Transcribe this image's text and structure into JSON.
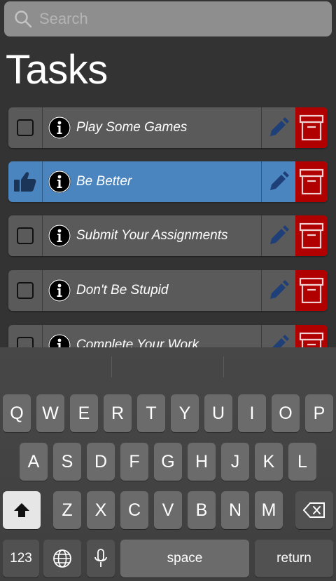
{
  "search": {
    "placeholder": "Search"
  },
  "page": {
    "title": "Tasks"
  },
  "tasks": [
    {
      "title": "Play Some Games",
      "completed": false,
      "selected": false
    },
    {
      "title": "Be Better",
      "completed": true,
      "selected": true
    },
    {
      "title": "Submit Your Assignments",
      "completed": false,
      "selected": false
    },
    {
      "title": "Don't Be Stupid",
      "completed": false,
      "selected": false
    },
    {
      "title": "Complete Your Work",
      "completed": false,
      "selected": false
    }
  ],
  "colors": {
    "background": "#333333",
    "row": "#5a5a5a",
    "row_selected": "#4a85c0",
    "archive": "#b00000",
    "edit_icon": "#1f3f78"
  },
  "icons": {
    "search": "search-icon",
    "checkbox": "checkbox-icon",
    "completed": "thumbs-up-icon",
    "info": "info-icon",
    "edit": "pencil-icon",
    "archive": "archive-box-icon"
  },
  "keyboard": {
    "row1": [
      "Q",
      "W",
      "E",
      "R",
      "T",
      "Y",
      "U",
      "I",
      "O",
      "P"
    ],
    "row2": [
      "A",
      "S",
      "D",
      "F",
      "G",
      "H",
      "J",
      "K",
      "L"
    ],
    "row3": [
      "Z",
      "X",
      "C",
      "V",
      "B",
      "N",
      "M"
    ],
    "numbers_label": "123",
    "space_label": "space",
    "return_label": "return"
  }
}
